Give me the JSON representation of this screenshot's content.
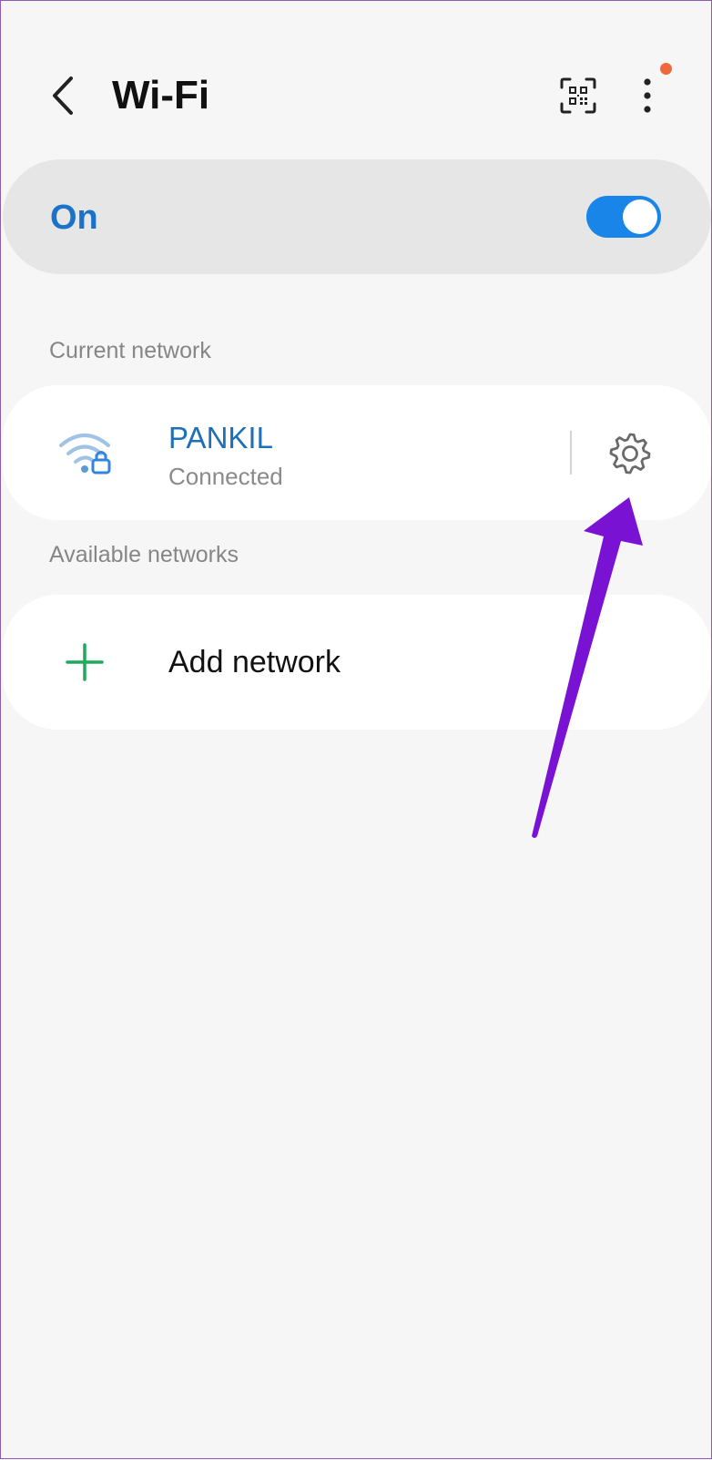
{
  "header": {
    "title": "Wi-Fi",
    "back_icon": "chevron-left-icon",
    "qr_icon": "qr-code-scan-icon",
    "more_icon": "more-vertical-icon",
    "notification_color": "#f0693a"
  },
  "wifi_toggle": {
    "label": "On",
    "state": "on",
    "label_color": "#1a73c8",
    "switch_color": "#1a85e8"
  },
  "current_network": {
    "section_label": "Current network",
    "name": "PANKIL",
    "status": "Connected",
    "name_color": "#1f6fb8",
    "wifi_icon": "wifi-lock-icon",
    "settings_icon": "gear-icon"
  },
  "available_networks": {
    "section_label": "Available networks",
    "add_label": "Add network",
    "add_icon": "plus-icon",
    "add_icon_color": "#1fa95a"
  },
  "annotation": {
    "arrow_color": "#7a12d4"
  }
}
